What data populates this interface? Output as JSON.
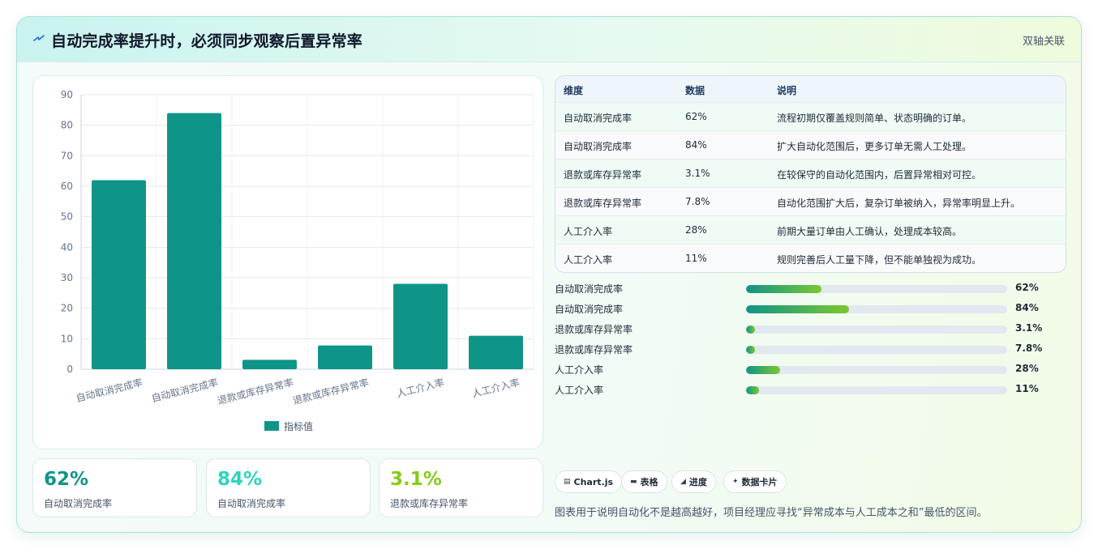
{
  "header": {
    "icon": "lightning-icon",
    "title": "自动完成率提升时，必须同步观察后置异常率",
    "tag": "双轴关联"
  },
  "chart_data": {
    "type": "bar",
    "categories": [
      "自动取消完成率",
      "自动取消完成率",
      "退款或库存异常率",
      "退款或库存异常率",
      "人工介入率",
      "人工介入率"
    ],
    "series": [
      {
        "name": "指标值",
        "values": [
          62,
          84,
          3.1,
          7.8,
          28,
          11
        ],
        "color": "#0f9488"
      }
    ],
    "ylim": [
      0,
      90
    ],
    "yticks": [
      0,
      10,
      20,
      30,
      40,
      50,
      60,
      70,
      80,
      90
    ],
    "grid": true,
    "legend": "bottom"
  },
  "kpis": [
    {
      "value": "62%",
      "label": "自动取消完成率",
      "color": "#0f9488"
    },
    {
      "value": "84%",
      "label": "自动取消完成率",
      "color": "#2dd4bf"
    },
    {
      "value": "3.1%",
      "label": "退款或库存异常率",
      "color": "#84cc16"
    }
  ],
  "table": {
    "headers": [
      "维度",
      "数据",
      "说明"
    ],
    "rows": [
      [
        "自动取消完成率",
        "62%",
        "流程初期仅覆盖规则简单、状态明确的订单。"
      ],
      [
        "自动取消完成率",
        "84%",
        "扩大自动化范围后，更多订单无需人工处理。"
      ],
      [
        "退款或库存异常率",
        "3.1%",
        "在较保守的自动化范围内，后置异常相对可控。"
      ],
      [
        "退款或库存异常率",
        "7.8%",
        "自动化范围扩大后，复杂订单被纳入，异常率明显上升。"
      ],
      [
        "人工介入率",
        "28%",
        "前期大量订单由人工确认，处理成本较高。"
      ],
      [
        "人工介入率",
        "11%",
        "规则完善后人工量下降，但不能单独视为成功。"
      ]
    ]
  },
  "progress": [
    {
      "label": "自动取消完成率",
      "value_text": "62%",
      "fraction": 0.29
    },
    {
      "label": "自动取消完成率",
      "value_text": "84%",
      "fraction": 0.395
    },
    {
      "label": "退款或库存异常率",
      "value_text": "3.1%",
      "fraction": 0.035
    },
    {
      "label": "退款或库存异常率",
      "value_text": "7.8%",
      "fraction": 0.035
    },
    {
      "label": "人工介入率",
      "value_text": "28%",
      "fraction": 0.13
    },
    {
      "label": "人工介入率",
      "value_text": "11%",
      "fraction": 0.05
    }
  ],
  "chips": [
    {
      "icon": "chart-icon",
      "label": "Chart.js"
    },
    {
      "icon": "table-icon",
      "label": "表格"
    },
    {
      "icon": "progress-icon",
      "label": "进度"
    },
    {
      "icon": "sparkle-icon",
      "label": "数据卡片"
    }
  ],
  "note": "图表用于说明自动化不是越高越好，项目经理应寻找“异常成本与人工成本之和”最低的区间。"
}
